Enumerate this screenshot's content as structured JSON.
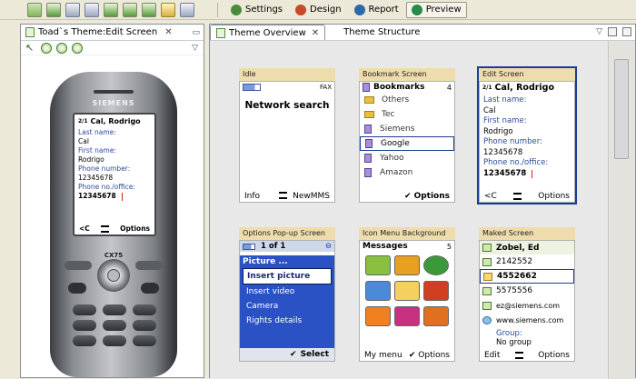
{
  "toolbar": {
    "icons": [
      "new-theme-icon",
      "open-icon",
      "save-icon",
      "save-as-icon",
      "curve-tool-icon",
      "lasso-tool-icon",
      "cursor-icon",
      "zoom-icon",
      "grid-icon"
    ],
    "buttons": [
      {
        "label": "Settings",
        "icon": "settings-icon",
        "color": "#4a8a3a"
      },
      {
        "label": "Design",
        "icon": "design-icon",
        "color": "#c84a2a"
      },
      {
        "label": "Report",
        "icon": "report-icon",
        "color": "#2a6aa8"
      },
      {
        "label": "Preview",
        "icon": "preview-icon",
        "color": "#2a8a4a"
      }
    ]
  },
  "left_view": {
    "title": "Toad`s Theme:Edit Screen",
    "phone": {
      "brand": "SIEMENS",
      "model": "CX75",
      "screen": {
        "header": "Cal, Rodrigo",
        "header_icon": "2/1",
        "fields": [
          {
            "label": "Last name:",
            "value": "Cal"
          },
          {
            "label": "First name:",
            "value": "Rodrigo"
          },
          {
            "label": "Phone number:",
            "value": "12345678"
          },
          {
            "label": "Phone no./office:",
            "value": "12345678"
          }
        ],
        "softkey_left": "<C",
        "softkey_right": "Options"
      }
    }
  },
  "right_view": {
    "tabs": [
      {
        "label": "Theme Overview",
        "active": true
      },
      {
        "label": "Theme Structure",
        "active": false
      }
    ],
    "cards": {
      "idle": {
        "title": "Idle",
        "status_right": "FAX",
        "message": "Network search",
        "softkey_left": "Info",
        "softkey_right": "NewMMS"
      },
      "bookmark": {
        "title": "Bookmark Screen",
        "header": "Bookmarks",
        "count": "4",
        "items": [
          {
            "label": "Others",
            "type": "folder"
          },
          {
            "label": "Tec",
            "type": "folder"
          },
          {
            "label": "Siemens",
            "type": "bookmark"
          },
          {
            "label": "Google",
            "type": "bookmark",
            "selected": true
          },
          {
            "label": "Yahoo",
            "type": "bookmark"
          },
          {
            "label": "Amazon",
            "type": "bookmark"
          }
        ],
        "softkey_right": "Options"
      },
      "edit": {
        "title": "Edit Screen",
        "header": "Cal, Rodrigo",
        "header_icon": "2/1",
        "fields": [
          {
            "label": "Last name:",
            "value": "Cal"
          },
          {
            "label": "First name:",
            "value": "Rodrigo"
          },
          {
            "label": "Phone number:",
            "value": "12345678"
          },
          {
            "label": "Phone no./office:",
            "value": "12345678"
          }
        ],
        "softkey_left": "<C",
        "softkey_right": "Options"
      },
      "popup": {
        "title": "Options Pop-up Screen",
        "header": "1 of 1",
        "menu_title": "Picture ...",
        "items": [
          {
            "label": "Insert picture",
            "selected": true
          },
          {
            "label": "Insert video"
          },
          {
            "label": "Camera"
          },
          {
            "label": "Rights details"
          }
        ],
        "softkey": "Select"
      },
      "iconmenu": {
        "title": "Icon Menu Background",
        "header": "Messages",
        "count": "5",
        "icons": [
          {
            "name": "text-message-icon",
            "color": "#8ac040"
          },
          {
            "name": "phone-exchange-icon",
            "color": "#e8a020"
          },
          {
            "name": "internet-icon",
            "color": "#3a9a3a"
          },
          {
            "name": "camera-icon",
            "color": "#4a8ad8"
          },
          {
            "name": "envelope-icon",
            "color": "#f4d060"
          },
          {
            "name": "notebook-icon",
            "color": "#d04020"
          },
          {
            "name": "image-icon",
            "color": "#f08020"
          },
          {
            "name": "folder-icon",
            "color": "#c83080"
          },
          {
            "name": "tools-icon",
            "color": "#e07020"
          }
        ],
        "softkey_left": "My menu",
        "softkey_right": "Options"
      },
      "marked": {
        "title": "Maked Screen",
        "header": "Zobel, Ed",
        "items": [
          {
            "label": "2142552"
          },
          {
            "label": "4552662",
            "selected": true
          },
          {
            "label": "5575556"
          },
          {
            "label": "ez@siemens.com"
          },
          {
            "label": "www.siemens.com"
          }
        ],
        "group_label": "Group:",
        "group_value": "No group",
        "softkey_left": "Edit",
        "softkey_right": "Options"
      }
    }
  }
}
